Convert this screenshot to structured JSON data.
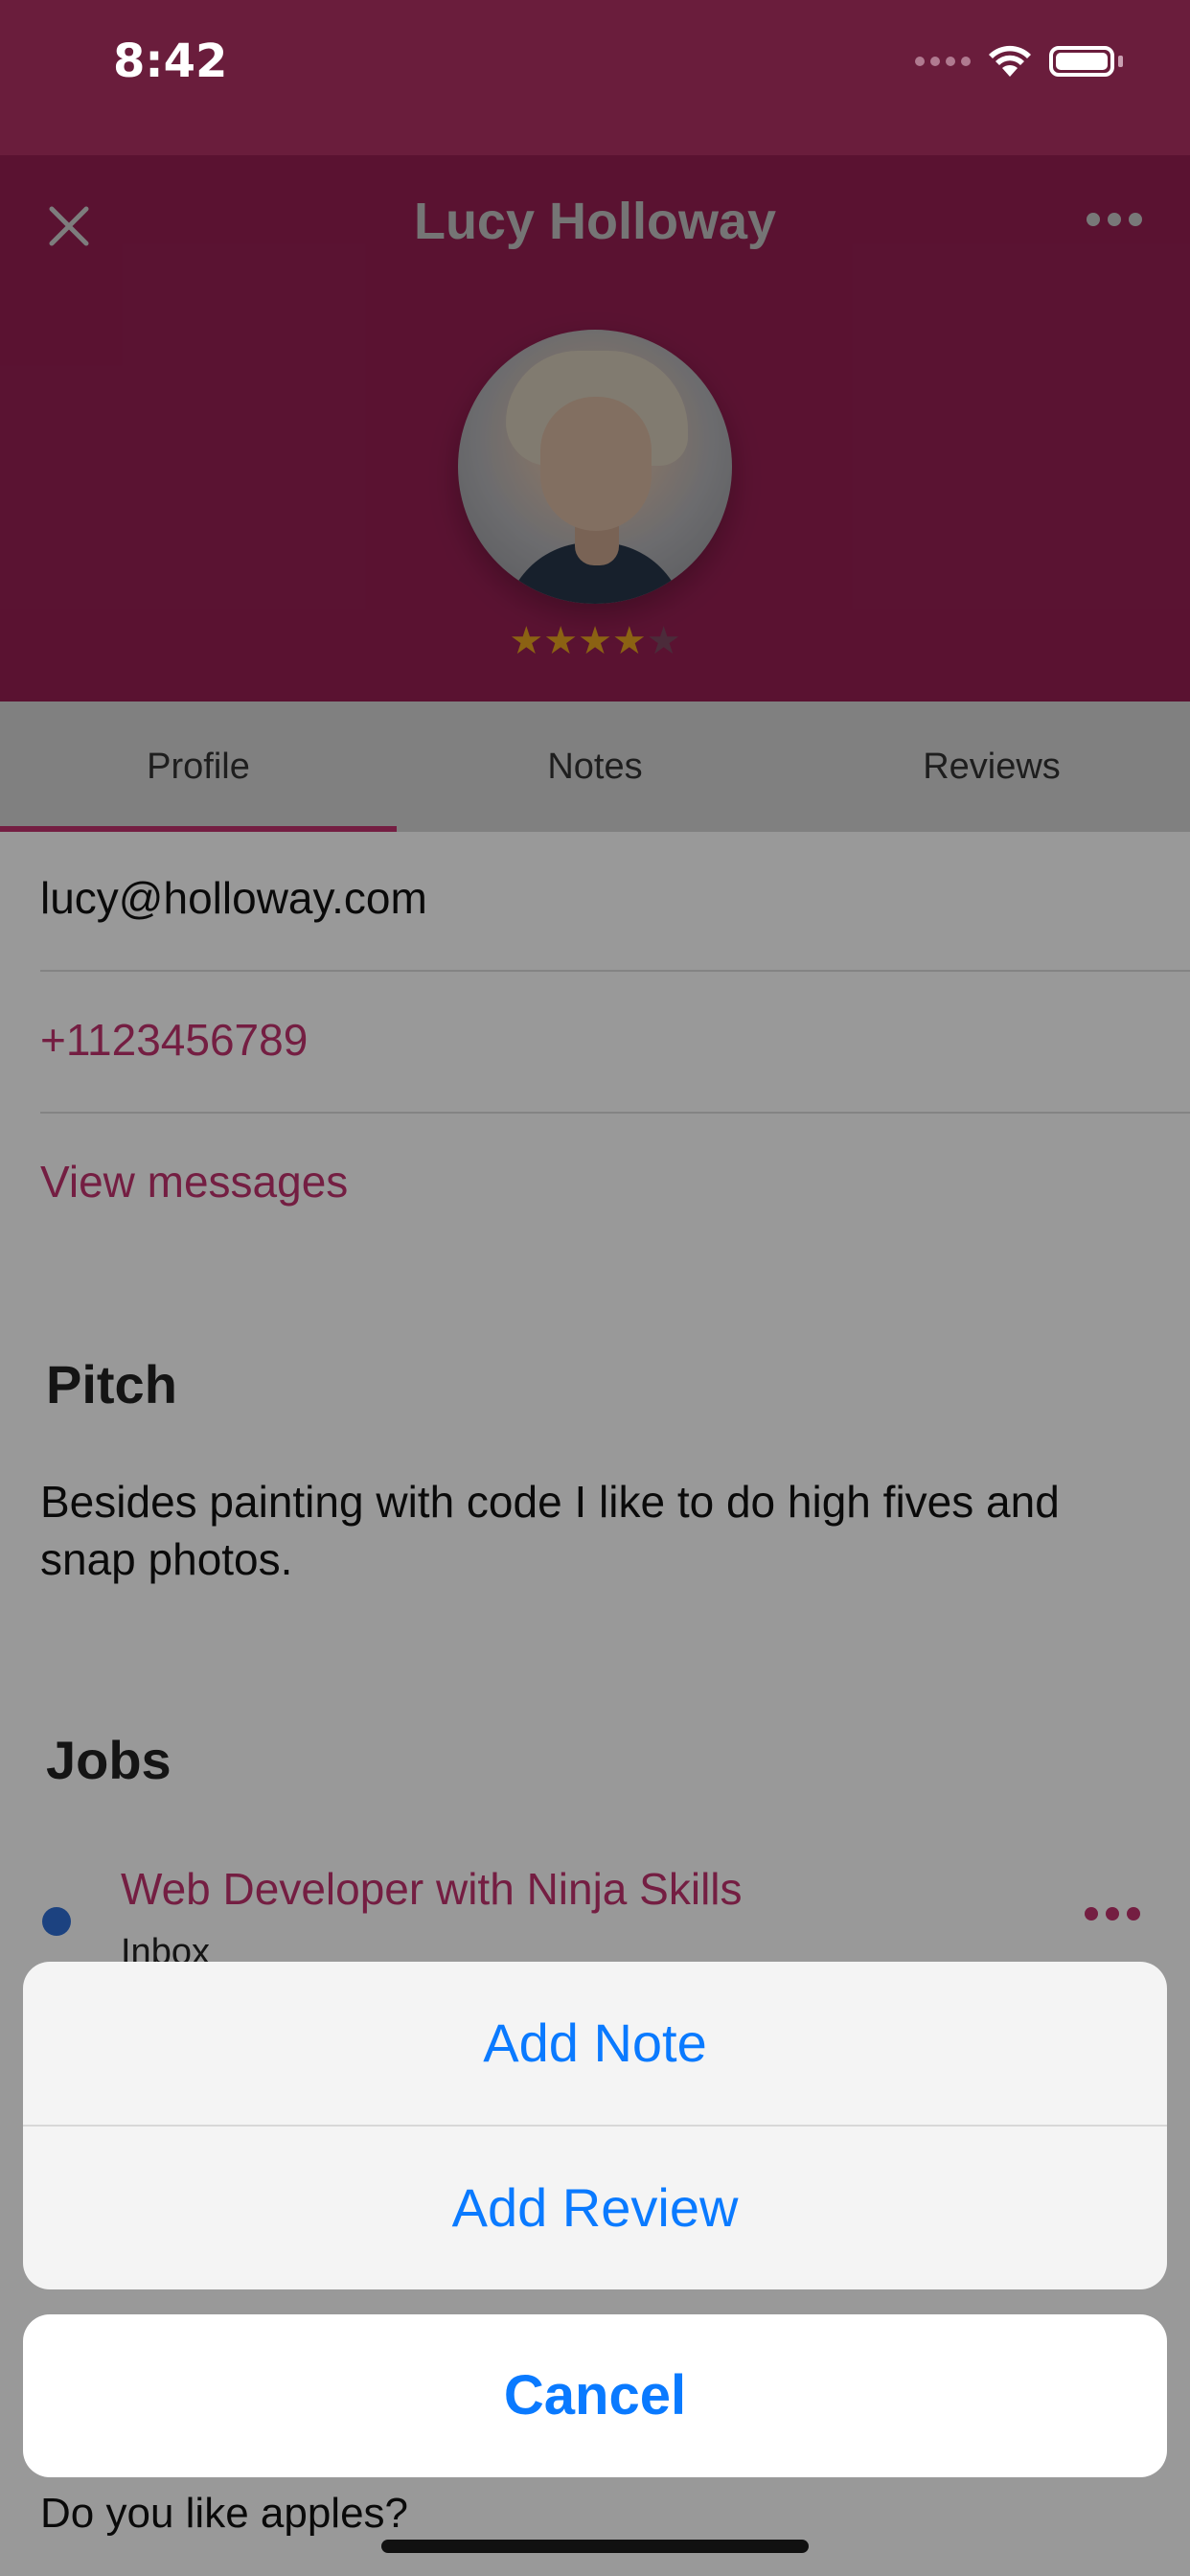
{
  "status_bar": {
    "time": "8:42"
  },
  "header": {
    "title": "Lucy Holloway",
    "rating": 4,
    "rating_max": 5
  },
  "tabs": [
    {
      "label": "Profile",
      "active": true
    },
    {
      "label": "Notes"
    },
    {
      "label": "Reviews"
    }
  ],
  "contact": {
    "email": "lucy@holloway.com",
    "phone": "+1123456789",
    "messages_link": "View messages"
  },
  "pitch": {
    "heading": "Pitch",
    "text": "Besides painting with code I like to do high fives and snap photos."
  },
  "jobs": {
    "heading": "Jobs",
    "items": [
      {
        "title": "Web Developer with Ninja Skills",
        "status": "Inbox"
      }
    ]
  },
  "question_partial": "Do you like apples?",
  "action_sheet": {
    "actions": [
      {
        "label": "Add Note"
      },
      {
        "label": "Add Review"
      }
    ],
    "cancel_label": "Cancel"
  },
  "colors": {
    "brand": "#961f53",
    "accent": "#c2336e",
    "ios_blue": "#0a7aff",
    "star": "#e8a320"
  }
}
